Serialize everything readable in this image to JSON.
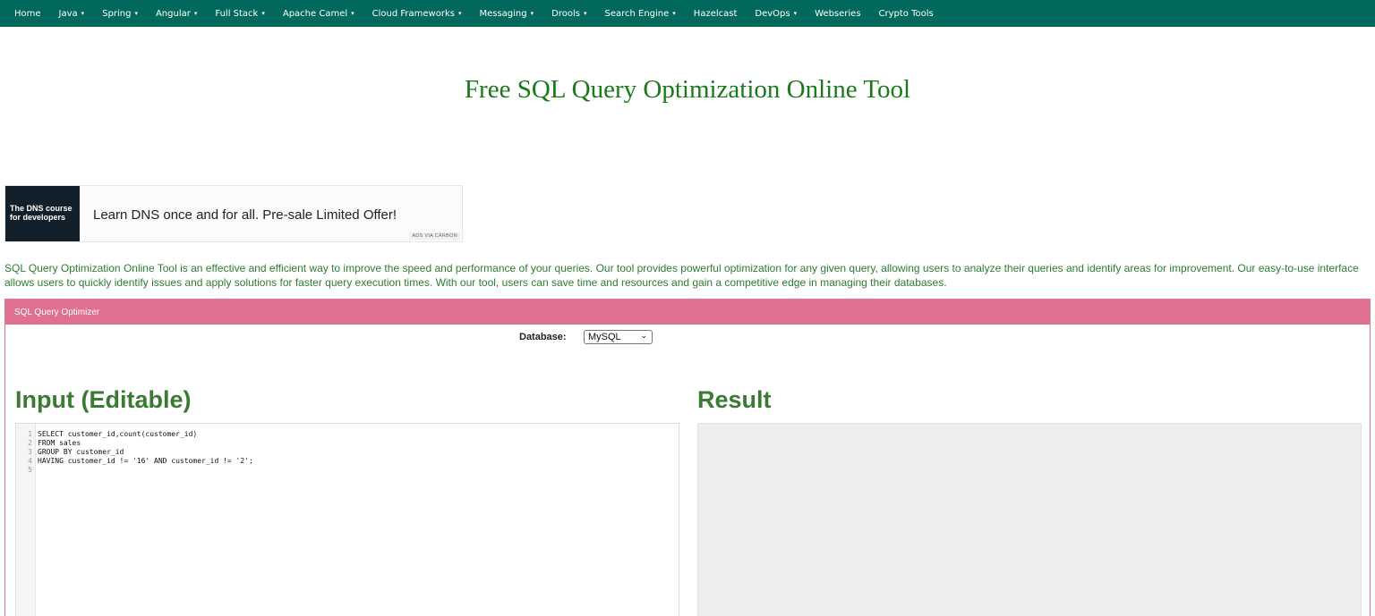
{
  "nav": {
    "items": [
      {
        "label": "Home",
        "dropdown": false
      },
      {
        "label": "Java",
        "dropdown": true
      },
      {
        "label": "Spring",
        "dropdown": true
      },
      {
        "label": "Angular",
        "dropdown": true
      },
      {
        "label": "Full Stack",
        "dropdown": true
      },
      {
        "label": "Apache Camel",
        "dropdown": true
      },
      {
        "label": "Cloud Frameworks",
        "dropdown": true
      },
      {
        "label": "Messaging",
        "dropdown": true
      },
      {
        "label": "Drools",
        "dropdown": true
      },
      {
        "label": "Search Engine",
        "dropdown": true
      },
      {
        "label": "Hazelcast",
        "dropdown": false
      },
      {
        "label": "DevOps",
        "dropdown": true
      },
      {
        "label": "Webseries",
        "dropdown": false
      },
      {
        "label": "Crypto Tools",
        "dropdown": false
      }
    ],
    "caret": "▾"
  },
  "page": {
    "title": "Free SQL Query Optimization Online Tool",
    "description": "SQL Query Optimization Online Tool is an effective and efficient way to improve the speed and performance of your queries. Our tool provides powerful optimization for any given query, allowing users to analyze their queries and identify areas for improvement. Our easy-to-use interface allows users to quickly identify issues and apply solutions for faster query execution times. With our tool, users can save time and resources and gain a competitive edge in managing their databases."
  },
  "ad": {
    "image_text": "The DNS course for developers",
    "text": "Learn DNS once and for all. Pre-sale Limited Offer!",
    "via": "ADS VIA CARBON"
  },
  "panel": {
    "heading": "SQL Query Optimizer",
    "database_label": "Database:",
    "database_value": "MySQL",
    "input_heading": "Input (Editable)",
    "result_heading": "Result"
  },
  "editor": {
    "line_numbers": [
      "1",
      "2",
      "3",
      "4",
      "5"
    ],
    "lines": [
      "SELECT customer_id,count(customer_id)",
      "FROM sales",
      "GROUP BY customer_id",
      "HAVING customer_id != '16' AND customer_id != '2';",
      ""
    ]
  },
  "colors": {
    "navbar": "#00695c",
    "title": "#1a7a1a",
    "panel_heading": "#e07092",
    "result_bg": "#eeeeee"
  }
}
